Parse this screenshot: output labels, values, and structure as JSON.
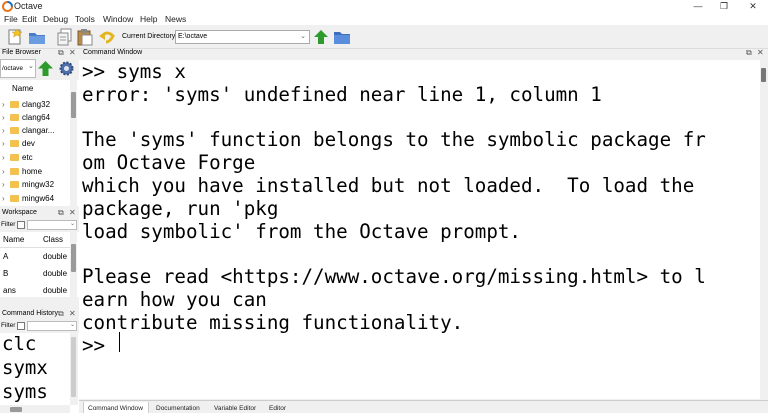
{
  "window": {
    "title": "Octave",
    "minimize_glyph": "—",
    "maximize_glyph": "❐",
    "close_glyph": "✕"
  },
  "menubar": {
    "items": [
      "File",
      "Edit",
      "Debug",
      "Tools",
      "Window",
      "Help",
      "News"
    ]
  },
  "toolbar": {
    "current_directory_label": "Current Directory:",
    "current_directory_value": "E:\\octave",
    "icons": [
      "new-script-icon",
      "open-folder-icon",
      "copy-icon",
      "paste-icon",
      "undo-icon",
      "go-up-icon",
      "browse-folder-icon"
    ]
  },
  "file_browser": {
    "title": "File Browser",
    "path": "/octave",
    "column_header": "Name",
    "items": [
      "clang32",
      "clang64",
      "clangar...",
      "dev",
      "etc",
      "home",
      "mingw32",
      "mingw64"
    ]
  },
  "workspace": {
    "title": "Workspace",
    "filter_label": "Filter",
    "columns": [
      "Name",
      "Class"
    ],
    "rows": [
      {
        "name": "A",
        "class": "double"
      },
      {
        "name": "B",
        "class": "double"
      },
      {
        "name": "ans",
        "class": "double"
      }
    ]
  },
  "command_history": {
    "title": "Command History",
    "filter_label": "Filter",
    "items": [
      "clc",
      "symx",
      "syms"
    ]
  },
  "command_window": {
    "title": "Command Window",
    "lines": [
      ">> syms x",
      "error: 'syms' undefined near line 1, column 1",
      "",
      "The 'syms' function belongs to the symbolic package fr",
      "om Octave Forge",
      "which you have installed but not loaded.  To load the",
      "package, run 'pkg",
      "load symbolic' from the Octave prompt.",
      "",
      "Please read <https://www.octave.org/missing.html> to l",
      "earn how you can",
      "contribute missing functionality.",
      ">> "
    ]
  },
  "tabs": [
    "Command Window",
    "Documentation",
    "Variable Editor",
    "Editor"
  ],
  "colors": {
    "folder": "#f2c14e",
    "arrow_green": "#2e9a2e",
    "logo_orange": "#e8741c",
    "logo_blue": "#1d6fb8"
  }
}
